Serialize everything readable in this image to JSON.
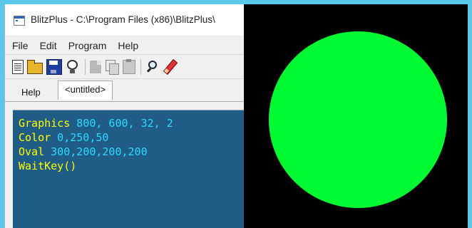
{
  "ide": {
    "title": "BlitzPlus - C:\\Program Files (x86)\\BlitzPlus\\",
    "menu": [
      "File",
      "Edit",
      "Program",
      "Help"
    ],
    "toolbar_icons": [
      "new-file-icon",
      "open-folder-icon",
      "save-icon",
      "lightbulb-icon",
      "cut-icon",
      "copy-icon",
      "paste-icon",
      "find-icon",
      "edit-icon"
    ],
    "tabs": [
      "Help",
      "<untitled>"
    ],
    "active_tab": 1,
    "code": [
      {
        "kw": "Graphics",
        "args": " 800, 600, 32, 2"
      },
      {
        "kw": "Color",
        "args": " 0,250,50"
      },
      {
        "kw": "Oval",
        "args": " 300,200,200,200"
      },
      {
        "kw": "WaitKey()",
        "args": ""
      }
    ],
    "colors": {
      "editor_background": "#1f5d86",
      "keyword": "#ffff00",
      "number": "#30d8ff"
    }
  },
  "output": {
    "background": "#000000",
    "oval_color": "#00fa32"
  }
}
